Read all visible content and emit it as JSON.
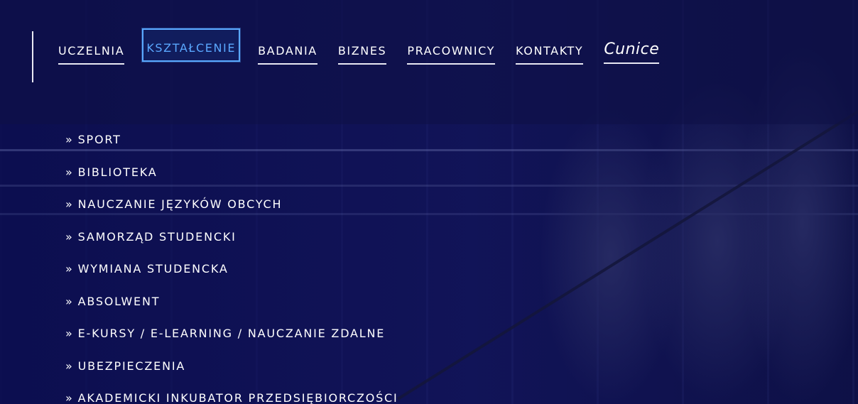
{
  "nav": {
    "items": [
      {
        "label": "UCZELNIA",
        "active": false
      },
      {
        "label": "KSZTAŁCENIE",
        "active": true
      },
      {
        "label": "BADANIA",
        "active": false
      },
      {
        "label": "BIZNES",
        "active": false
      },
      {
        "label": "PRACOWNICY",
        "active": false
      },
      {
        "label": "KONTAKTY",
        "active": false
      }
    ],
    "logo_text": "Cunice"
  },
  "submenu": {
    "prefix": "»",
    "items": [
      "SPORT",
      "BIBLIOTEKA",
      "NAUCZANIE JĘZYKÓW OBCYCH",
      "SAMORZĄD STUDENCKI",
      "WYMIANA STUDENCKA",
      "ABSOLWENT",
      "E-KURSY / E-LEARNING / NAUCZANIE ZDALNE",
      "UBEZPIECZENIA",
      "AKADEMICKI INKUBATOR PRZEDSIĘBIORCZOŚCI"
    ]
  },
  "colors": {
    "active_accent": "#5aa8ff",
    "text": "#ffffff",
    "overlay": "#0c0e50"
  }
}
